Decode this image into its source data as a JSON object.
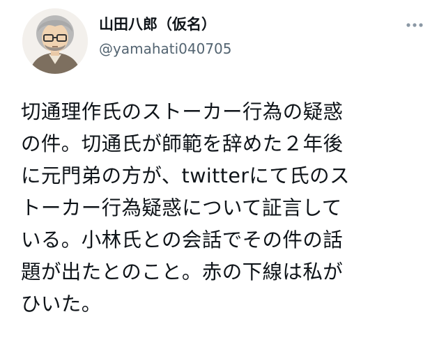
{
  "user": {
    "display_name": "山田八郎（仮名）",
    "handle": "@yamahati040705"
  },
  "icons": {
    "avatar": "cartoon-man-with-glasses-avatar",
    "more": "more-horizontal-icon"
  },
  "tweet": {
    "lines": [
      "切通理作氏のストーカー行為の疑惑",
      "の件。切通氏が師範を辞めた２年後",
      "に元門弟の方が、twitterにて氏のス",
      "トーカー行為疑惑について証言して",
      "いる。小林氏との会話でその件の話",
      "題が出たとのこと。赤の下線は私が",
      "ひいた。"
    ]
  },
  "colors": {
    "text": "#0f1419",
    "secondary": "#536471",
    "background": "#ffffff"
  }
}
